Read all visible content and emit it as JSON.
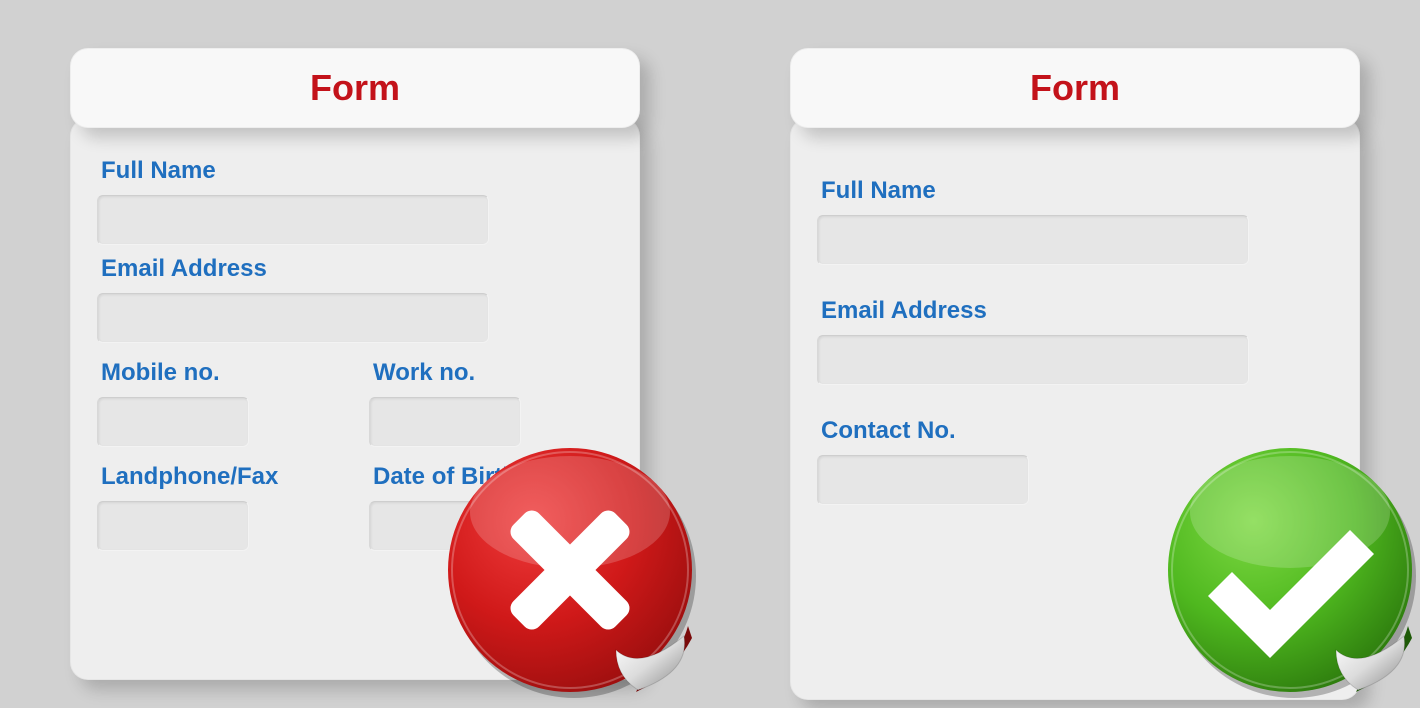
{
  "bad_form": {
    "title": "Form",
    "fields": {
      "full_name": "Full Name",
      "email": "Email Address",
      "mobile": "Mobile no.",
      "work": "Work no.",
      "landphone": "Landphone/Fax",
      "dob": "Date of Birth"
    },
    "status": "incorrect"
  },
  "good_form": {
    "title": "Form",
    "fields": {
      "full_name": "Full Name",
      "email": "Email Address",
      "contact": "Contact No."
    },
    "status": "correct"
  },
  "colors": {
    "title": "#c3121a",
    "label": "#1f6fbf",
    "bad_sticker": "#cc1717",
    "good_sticker": "#4fb81f"
  }
}
